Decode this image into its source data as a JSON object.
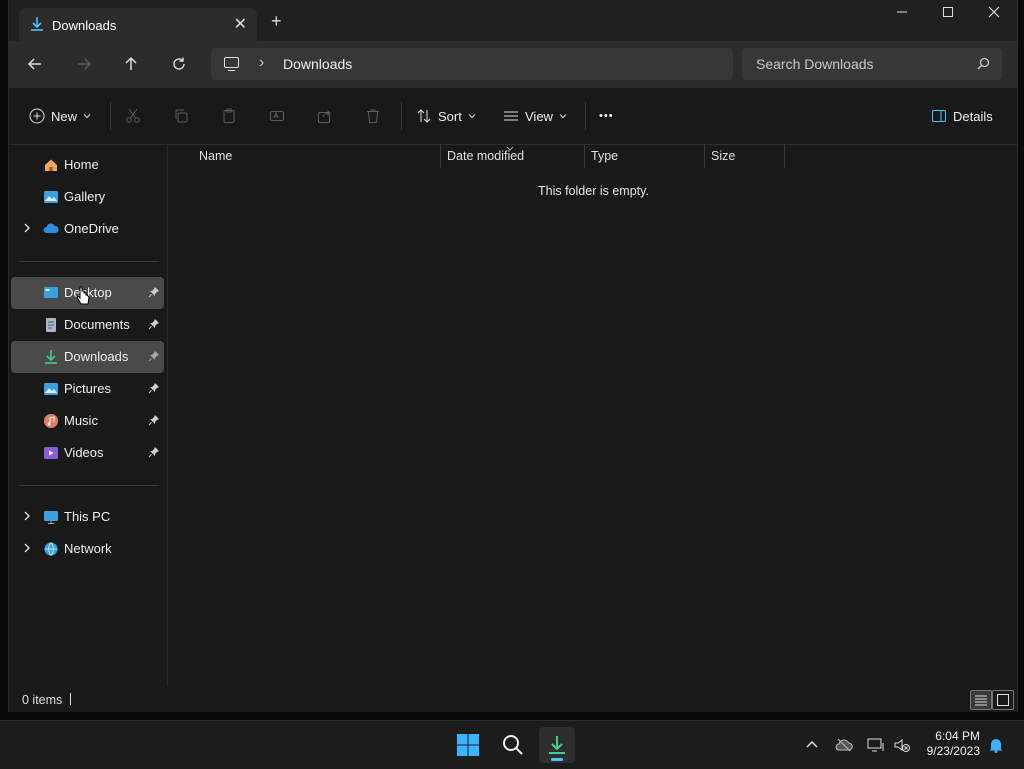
{
  "window": {
    "tab_title": "Downloads",
    "tab_close": "✕",
    "new_tab": "+"
  },
  "navbar": {
    "breadcrumb_sep": "›",
    "address": "Downloads",
    "search_placeholder": "Search Downloads"
  },
  "commandbar": {
    "new_label": "New",
    "sort_label": "Sort",
    "view_label": "View",
    "more_label": "•••",
    "details_label": "Details"
  },
  "sidebar": {
    "quick": [
      {
        "label": "Home",
        "icon": "home-icon"
      },
      {
        "label": "Gallery",
        "icon": "gallery-icon"
      },
      {
        "label": "OneDrive",
        "icon": "onedrive-icon"
      }
    ],
    "pinned": [
      {
        "label": "Desktop",
        "icon": "desktop-icon"
      },
      {
        "label": "Documents",
        "icon": "documents-icon"
      },
      {
        "label": "Downloads",
        "icon": "downloads-icon"
      },
      {
        "label": "Pictures",
        "icon": "pictures-icon"
      },
      {
        "label": "Music",
        "icon": "music-icon"
      },
      {
        "label": "Videos",
        "icon": "videos-icon"
      }
    ],
    "devices": [
      {
        "label": "This PC",
        "icon": "this-pc-icon"
      },
      {
        "label": "Network",
        "icon": "network-icon"
      }
    ]
  },
  "content": {
    "columns": [
      "Name",
      "Date modified",
      "Type",
      "Size"
    ],
    "empty_message": "This folder is empty."
  },
  "statusbar": {
    "item_count": "0 items"
  },
  "taskbar": {
    "time": "6:04 PM",
    "date": "9/23/2023"
  },
  "colors": {
    "accent": "#4cc2ff",
    "window_bg": "#191919",
    "selected_bg": "#4a4a4a"
  }
}
